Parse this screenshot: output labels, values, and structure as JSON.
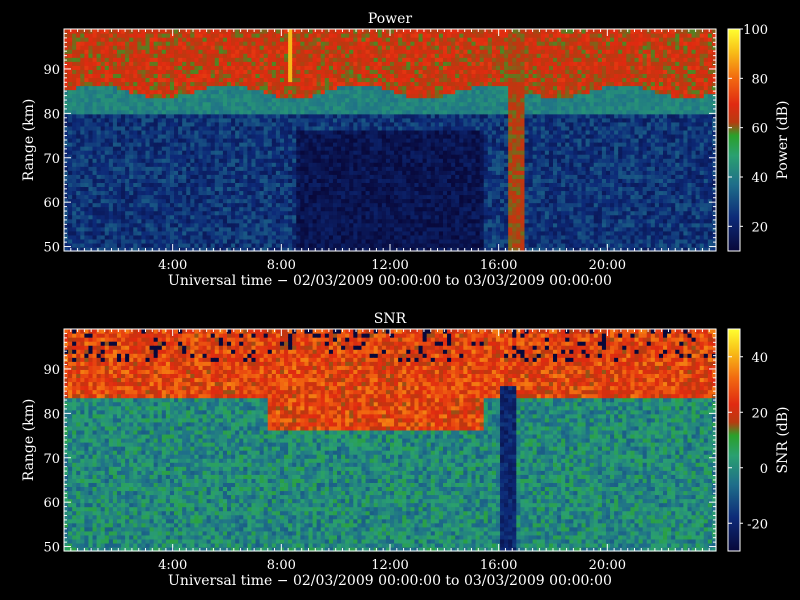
{
  "chart_data": [
    {
      "type": "heatmap",
      "title": "Power",
      "xlabel": "Universal time − 02/03/2009 00:00:00 to 03/03/2009 00:00:00",
      "ylabel": "Range (km)",
      "x_range_hours": [
        0,
        24
      ],
      "x_ticks": [
        "4:00",
        "8:00",
        "12:00",
        "16:00",
        "20:00"
      ],
      "x_tick_hours": [
        4,
        8,
        12,
        16,
        20
      ],
      "ylim": [
        49,
        99
      ],
      "y_ticks": [
        50,
        60,
        70,
        80,
        90
      ],
      "colorbar": {
        "label": "Power (dB)",
        "range": [
          10,
          100
        ],
        "ticks": [
          20,
          40,
          60,
          80,
          100
        ]
      },
      "description_values": {
        "upper_layer_km": [
          85,
          99
        ],
        "upper_layer_value_db": 65,
        "transition_km": [
          80,
          85
        ],
        "transition_value_db": 42,
        "lower_region_value_db": 25,
        "night_minimum_value_db": 15,
        "night_minimum_hours": [
          8.5,
          15.5
        ],
        "night_minimum_top_km": 76,
        "high_band_hours": [
          16.3,
          16.9
        ],
        "high_band_value_db": 62,
        "peak_spot_hours": [
          8.2,
          8.4
        ],
        "peak_spot_km": [
          87,
          99
        ],
        "peak_spot_value_db": 90
      }
    },
    {
      "type": "heatmap",
      "title": "SNR",
      "xlabel": "Universal time − 02/03/2009 00:00:00 to 03/03/2009 00:00:00",
      "ylabel": "Range (km)",
      "x_range_hours": [
        0,
        24
      ],
      "x_ticks": [
        "4:00",
        "8:00",
        "12:00",
        "16:00",
        "20:00"
      ],
      "x_tick_hours": [
        4,
        8,
        12,
        16,
        20
      ],
      "ylim": [
        49,
        99
      ],
      "y_ticks": [
        50,
        60,
        70,
        80,
        90
      ],
      "colorbar": {
        "label": "SNR (dB)",
        "range": [
          -30,
          50
        ],
        "ticks": [
          -20,
          0,
          20,
          40
        ]
      },
      "description_values": {
        "upper_layer_km": [
          84,
          99
        ],
        "upper_layer_value_db": 25,
        "lower_region_value_db": 0,
        "daytime_enhanced_hours": [
          7.5,
          15.5
        ],
        "daytime_enhanced_bottom_km": 76,
        "low_band_hours": [
          16.0,
          16.6
        ],
        "low_band_value_db": -20
      }
    }
  ]
}
